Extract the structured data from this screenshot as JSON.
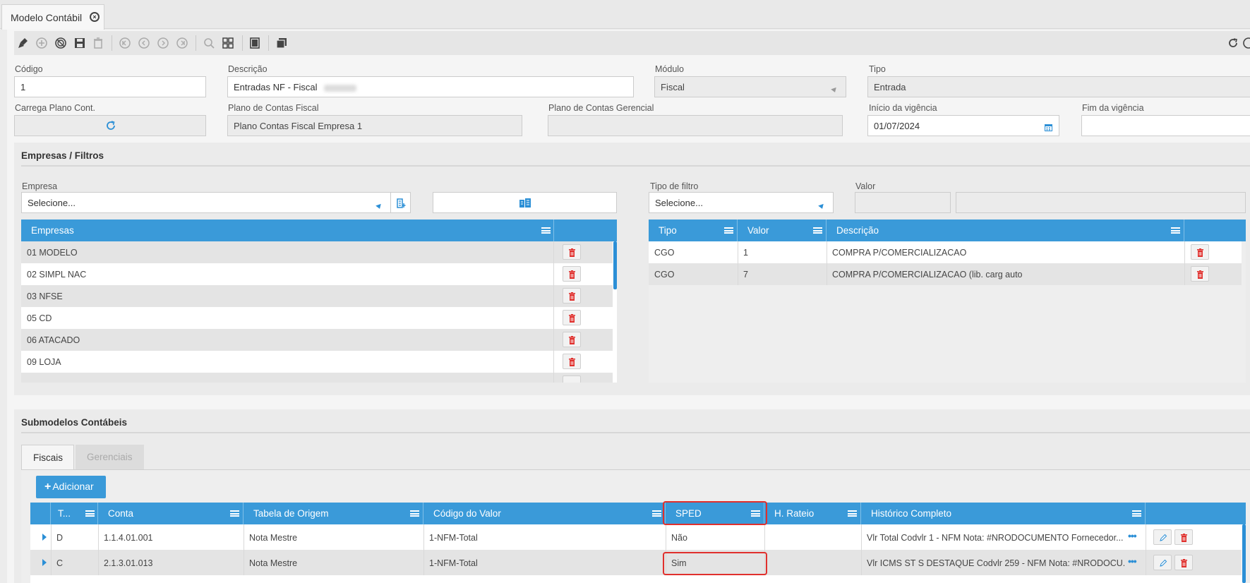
{
  "window": {
    "tab_title": "Modelo Contábil"
  },
  "toolbar": {
    "icons": [
      "broom-icon",
      "add-circle-icon",
      "cancel-circle-icon",
      "save-icon",
      "trash-icon",
      "first-icon",
      "prev-icon",
      "next-icon",
      "last-icon",
      "search-icon",
      "grid-icon",
      "square-icon",
      "copy-icon",
      "refresh-icon"
    ]
  },
  "form": {
    "codigo_label": "Código",
    "codigo_value": "1",
    "descricao_label": "Descrição",
    "descricao_value": "Entradas NF - Fiscal",
    "modulo_label": "Módulo",
    "modulo_value": "Fiscal",
    "tipo_label": "Tipo",
    "tipo_value": "Entrada",
    "carrega_label": "Carrega Plano Cont.",
    "plano_fiscal_label": "Plano de Contas Fiscal",
    "plano_fiscal_value": "Plano Contas Fiscal Empresa 1",
    "plano_gerencial_label": "Plano de Contas Gerencial",
    "plano_gerencial_value": "",
    "inicio_label": "Início da vigência",
    "inicio_value": "01/07/2024",
    "fim_label": "Fim da vigência",
    "fim_value": ""
  },
  "empresas_filtros": {
    "title": "Empresas / Filtros",
    "empresa_label": "Empresa",
    "empresa_value": "Selecione...",
    "tipo_filtro_label": "Tipo de filtro",
    "tipo_filtro_value": "Selecione...",
    "valor_label": "Valor",
    "empresas_grid": {
      "header": "Empresas",
      "rows": [
        "01 MODELO",
        "02 SIMPL NAC",
        "03 NFSE",
        "05 CD",
        "06 ATACADO",
        "09 LOJA"
      ]
    },
    "filtros_grid": {
      "headers": [
        "Tipo",
        "Valor",
        "Descrição"
      ],
      "rows": [
        [
          "CGO",
          "1",
          "COMPRA P/COMERCIALIZACAO"
        ],
        [
          "CGO",
          "7",
          "COMPRA P/COMERCIALIZACAO (lib. carg auto"
        ]
      ]
    }
  },
  "submodelos": {
    "title": "Submodelos Contábeis",
    "tabs": [
      "Fiscais",
      "Gerenciais"
    ],
    "add_label": "Adicionar",
    "headers": [
      "T...",
      "Conta",
      "Tabela de Origem",
      "Código do Valor",
      "SPED",
      "H. Rateio",
      "Histórico Completo"
    ],
    "rows": [
      [
        "D",
        "1.1.4.01.001",
        "Nota Mestre",
        "1-NFM-Total",
        "Não",
        "",
        "Vlr Total Codvlr 1 - NFM Nota: #NRODOCUMENTO Fornecedor..."
      ],
      [
        "C",
        "2.1.3.01.013",
        "Nota Mestre",
        "1-NFM-Total",
        "Sim",
        "",
        "Vlr ICMS ST S DESTAQUE Codvlr 259 - NFM Nota: #NRODOCU..."
      ]
    ]
  },
  "colors": {
    "accent": "#3a9ad9",
    "highlight": "#e0302d",
    "trash": "#e0302d"
  }
}
